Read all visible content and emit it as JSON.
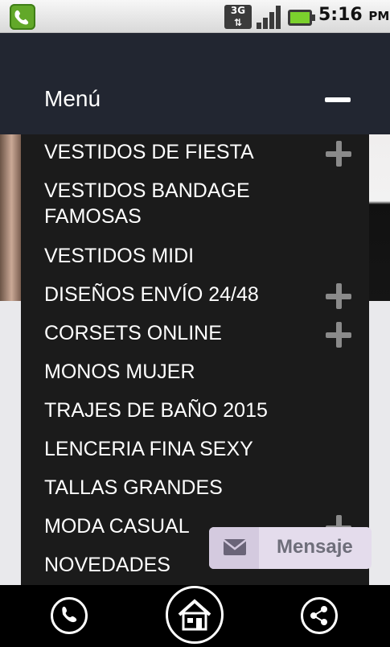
{
  "status_bar": {
    "network": "3G",
    "time": "5:16",
    "ampm": "PM",
    "icons": [
      "phone-app-icon",
      "network-3g-icon",
      "signal-icon",
      "battery-charging-icon"
    ]
  },
  "menu": {
    "title": "Menú",
    "items": [
      {
        "label": "VESTIDOS DE FIESTA",
        "expandable": true
      },
      {
        "label": "VESTIDOS BANDAGE",
        "label2": "FAMOSAS",
        "expandable": false
      },
      {
        "label": "VESTIDOS MIDI",
        "expandable": false
      },
      {
        "label": "DISEÑOS ENVÍO 24/48",
        "expandable": true
      },
      {
        "label": "CORSETS ONLINE",
        "expandable": true
      },
      {
        "label": "MONOS MUJER",
        "expandable": false
      },
      {
        "label": "TRAJES DE BAÑO 2015",
        "expandable": false
      },
      {
        "label": "LENCERIA FINA SEXY",
        "expandable": false
      },
      {
        "label": "TALLAS GRANDES",
        "expandable": false
      },
      {
        "label": "MODA CASUAL",
        "expandable": true
      },
      {
        "label": "NOVEDADES",
        "expandable": false
      }
    ]
  },
  "message_button": {
    "label": "Mensaje"
  },
  "bottom_nav": [
    "phone-icon",
    "home-icon",
    "share-icon"
  ],
  "colors": {
    "header": "#222631",
    "panel": "#1b1b1b",
    "plus": "#8a8a8a",
    "message_bg": "#e4dcec"
  }
}
